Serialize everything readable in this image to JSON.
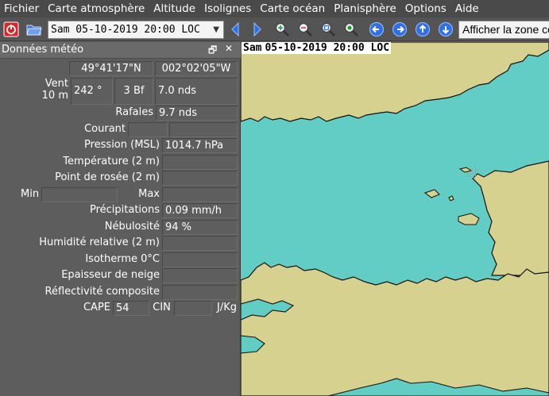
{
  "menu": [
    "Fichier",
    "Carte atmosphère",
    "Altitude",
    "Isolignes",
    "Carte océan",
    "Planisphère",
    "Options",
    "Aide"
  ],
  "toolbar": {
    "date_value": "Sam 05-10-2019 20:00 LOC",
    "zone_button": "Afficher la zone co",
    "icons": [
      "quit-icon",
      "open-folder-icon",
      "previous-icon",
      "next-icon",
      "zoom-in-icon",
      "zoom-out-icon",
      "zoom-fit-icon",
      "zoom-all-icon",
      "pan-left-icon",
      "pan-right-icon",
      "pan-up-icon",
      "pan-down-icon"
    ]
  },
  "panel": {
    "title": "Données météo",
    "lat": "49°41'17\"N",
    "lon": "002°02'05\"W",
    "vent_label_1": "Vent",
    "vent_label_2": "10 m",
    "vent_dir": "242 °",
    "vent_bf": "3 Bf",
    "vent_speed": "7.0  nds",
    "rafales_label": "Rafales",
    "rafales_value": "9.7  nds",
    "courant_label": "Courant",
    "courant_value_1": "",
    "courant_value_2": "",
    "pression_label": "Pression (MSL)",
    "pression_value": "1014.7 hPa",
    "temperature_label": "Température (2 m)",
    "temperature_value": "",
    "rosee_label": "Point de rosée (2 m)",
    "rosee_value": "",
    "min_label": "Min",
    "min_value": "",
    "max_label": "Max",
    "max_value": "",
    "precip_label": "Précipitations",
    "precip_value": "0.09 mm/h",
    "nebulosite_label": "Nébulosité",
    "nebulosite_value": "94 %",
    "humidite_label": "Humidité relative (2 m)",
    "humidite_value": "",
    "isotherme_label": "Isotherme 0°C",
    "isotherme_value": "",
    "neige_label": "Epaisseur de neige",
    "neige_value": "",
    "reflect_label": "Réflectivité composite",
    "reflect_value": "",
    "cape_label": "CAPE",
    "cape_value": "54",
    "cin_label": "CIN",
    "cin_value": "",
    "cape_unit": "J/Kg"
  },
  "map": {
    "day": "Sam",
    "timestamp": "05-10-2019 20:00 LOC",
    "sea_color": "#62cdc4",
    "land_color": "#d6d18f"
  }
}
